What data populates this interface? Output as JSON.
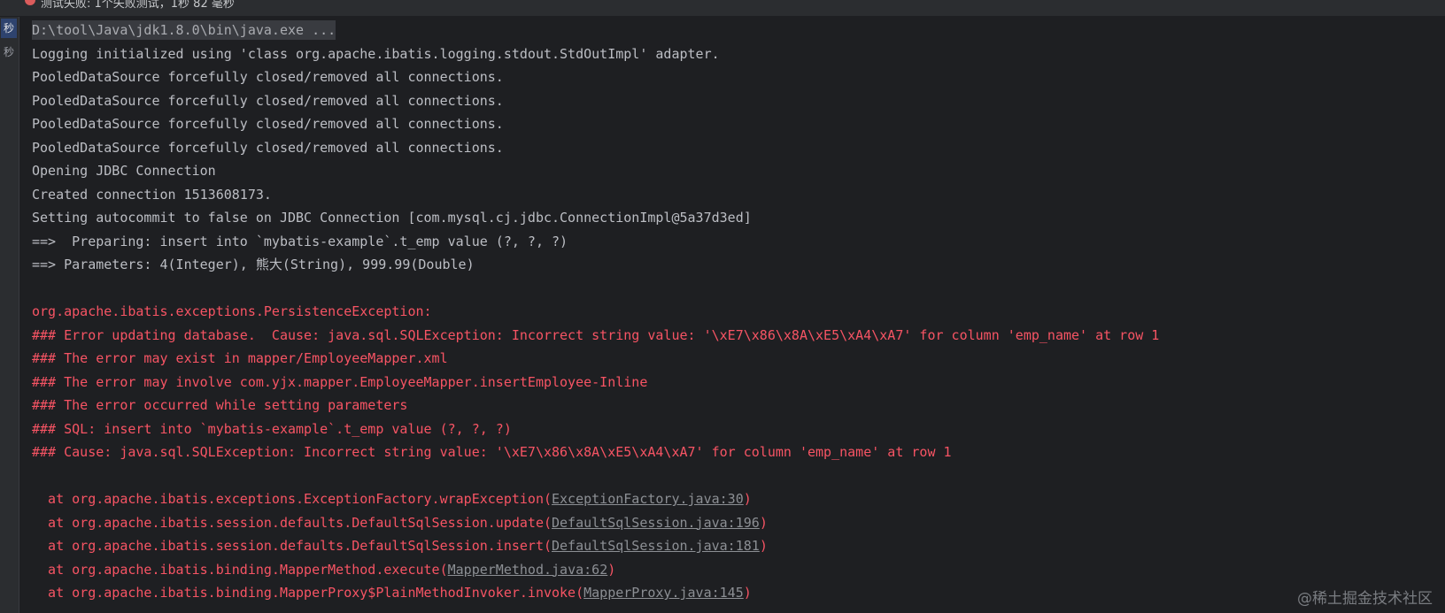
{
  "window": {
    "title": "测试失败: 1个失败测试，1秒 82 毫秒"
  },
  "gutter": {
    "items": [
      {
        "label": "秒"
      },
      {
        "label": "秒"
      }
    ]
  },
  "console": {
    "command_line": "D:\\tool\\Java\\jdk1.8.0\\bin\\java.exe ...",
    "info_lines": [
      "Logging initialized using 'class org.apache.ibatis.logging.stdout.StdOutImpl' adapter.",
      "PooledDataSource forcefully closed/removed all connections.",
      "PooledDataSource forcefully closed/removed all connections.",
      "PooledDataSource forcefully closed/removed all connections.",
      "PooledDataSource forcefully closed/removed all connections.",
      "Opening JDBC Connection",
      "Created connection 1513608173.",
      "Setting autocommit to false on JDBC Connection [com.mysql.cj.jdbc.ConnectionImpl@5a37d3ed]",
      "==>  Preparing: insert into `mybatis-example`.t_emp value (?, ?, ?)",
      "==> Parameters: 4(Integer), 熊大(String), 999.99(Double)"
    ],
    "error_lines": [
      "org.apache.ibatis.exceptions.PersistenceException: ",
      "### Error updating database.  Cause: java.sql.SQLException: Incorrect string value: '\\xE7\\x86\\x8A\\xE5\\xA4\\xA7' for column 'emp_name' at row 1",
      "### The error may exist in mapper/EmployeeMapper.xml",
      "### The error may involve com.yjx.mapper.EmployeeMapper.insertEmployee-Inline",
      "### The error occurred while setting parameters",
      "### SQL: insert into `mybatis-example`.t_emp value (?, ?, ?)",
      "### Cause: java.sql.SQLException: Incorrect string value: '\\xE7\\x86\\x8A\\xE5\\xA4\\xA7' for column 'emp_name' at row 1"
    ],
    "stack_frames": [
      {
        "prefix": "  at org.apache.ibatis.exceptions.ExceptionFactory.wrapException(",
        "link": "ExceptionFactory.java:30",
        "suffix": ")"
      },
      {
        "prefix": "  at org.apache.ibatis.session.defaults.DefaultSqlSession.update(",
        "link": "DefaultSqlSession.java:196",
        "suffix": ")"
      },
      {
        "prefix": "  at org.apache.ibatis.session.defaults.DefaultSqlSession.insert(",
        "link": "DefaultSqlSession.java:181",
        "suffix": ")"
      },
      {
        "prefix": "  at org.apache.ibatis.binding.MapperMethod.execute(",
        "link": "MapperMethod.java:62",
        "suffix": ")"
      },
      {
        "prefix": "  at org.apache.ibatis.binding.MapperProxy$PlainMethodInvoker.invoke(",
        "link": "MapperProxy.java:145",
        "suffix": ")"
      }
    ]
  },
  "watermark": "@稀土掘金技术社区",
  "colors": {
    "background": "#1e1f22",
    "text": "#bcbec4",
    "error": "#f75464",
    "link": "#8c8f94",
    "gutter_active": "#2e436e"
  }
}
